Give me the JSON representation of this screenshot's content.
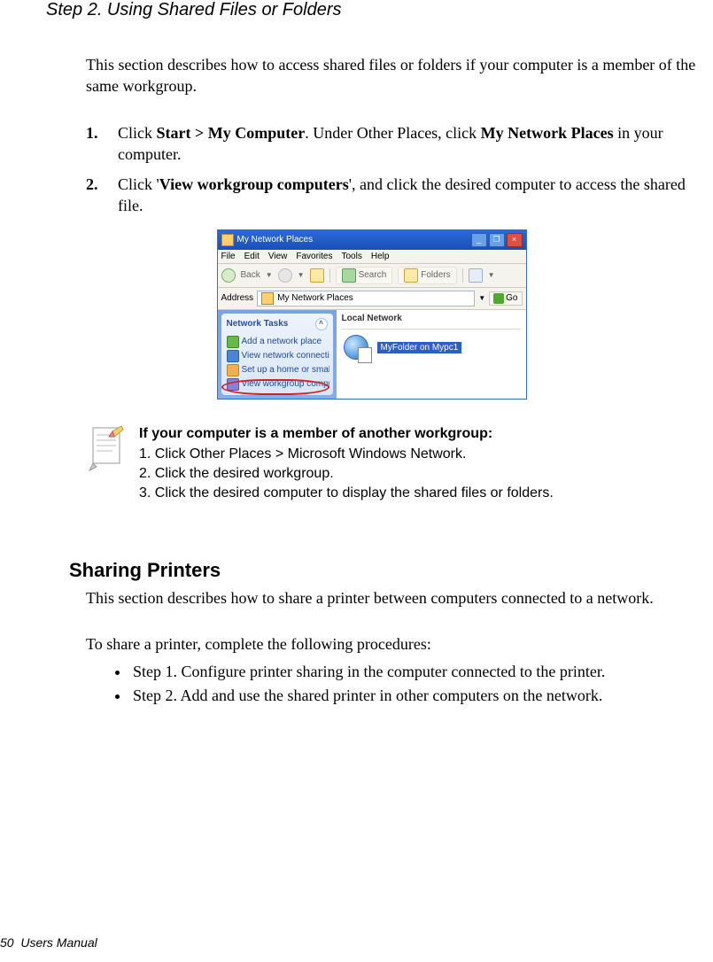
{
  "step_title": "Step 2. Using Shared Files or Folders",
  "intro": "This section describes how to access shared files or folders if your computer is a member of the same workgroup.",
  "ol": [
    {
      "pre": "Click ",
      "bold1": "Start > My Computer",
      "mid": ". Under Other Places, click ",
      "bold2": "My Network Places",
      "post": " in your computer."
    },
    {
      "pre": "Click '",
      "bold1": "View workgroup computers",
      "mid": "', and click the desired computer to access the shared file.",
      "bold2": "",
      "post": ""
    }
  ],
  "screenshot": {
    "title": "My Network Places",
    "menu": [
      "File",
      "Edit",
      "View",
      "Favorites",
      "Tools",
      "Help"
    ],
    "toolbar": {
      "back": "Back",
      "search": "Search",
      "folders": "Folders"
    },
    "address_label": "Address",
    "address_value": "My Network Places",
    "go": "Go",
    "tasks_header": "Network Tasks",
    "tasks": [
      "Add a network place",
      "View network connections",
      "Set up a home or small",
      "View workgroup computers"
    ],
    "group_label": "Local Network",
    "item_label": "MyFolder on Mypc1"
  },
  "note": {
    "heading": "If your computer is a member of another workgroup:",
    "lines": [
      "1. Click Other Places > Microsoft Windows Network.",
      "2. Click the desired workgroup.",
      "3. Click the desired computer to display the shared files or folders."
    ]
  },
  "section2": {
    "heading": "Sharing Printers",
    "intro": "This section describes how to share a printer between computers connected to a network.",
    "lead": "To share a printer, complete the following procedures:",
    "bullets": [
      "Step 1. Configure printer sharing in the computer connected to the printer.",
      "Step 2. Add and use the shared printer in other computers on the network."
    ]
  },
  "footer": {
    "page": "50",
    "label": "Users Manual"
  }
}
